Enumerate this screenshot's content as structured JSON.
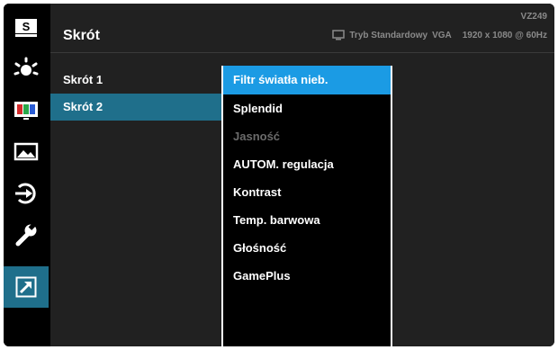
{
  "header": {
    "title": "Skrót",
    "model": "VZ249",
    "mode": "Tryb Standardowy",
    "input": "VGA",
    "resolution": "1920 x 1080 @ 60Hz"
  },
  "sidebar": {
    "items": [
      {
        "name": "splendid-icon",
        "label": "S"
      },
      {
        "name": "bluelight-filter-icon"
      },
      {
        "name": "color-icon"
      },
      {
        "name": "image-icon"
      },
      {
        "name": "input-select-icon"
      },
      {
        "name": "system-setup-icon"
      },
      {
        "name": "shortcut-icon",
        "active": true
      }
    ]
  },
  "level1": {
    "items": [
      {
        "label": "Skrót 1"
      },
      {
        "label": "Skrót 2",
        "active": true
      }
    ]
  },
  "level2": {
    "items": [
      {
        "label": "Filtr światła nieb.",
        "selected": true
      },
      {
        "label": "Splendid"
      },
      {
        "label": "Jasność",
        "disabled": true
      },
      {
        "label": "AUTOM. regulacja"
      },
      {
        "label": "Kontrast"
      },
      {
        "label": "Temp. barwowa"
      },
      {
        "label": "Głośność"
      },
      {
        "label": "GamePlus"
      }
    ]
  },
  "colors": {
    "background": "#212121",
    "sidebar": "#000000",
    "active": "#1f6f8b",
    "selected": "#1b9be4",
    "text": "#ffffff",
    "muted": "#8a8a8a",
    "disabled": "#6b6b6b"
  }
}
